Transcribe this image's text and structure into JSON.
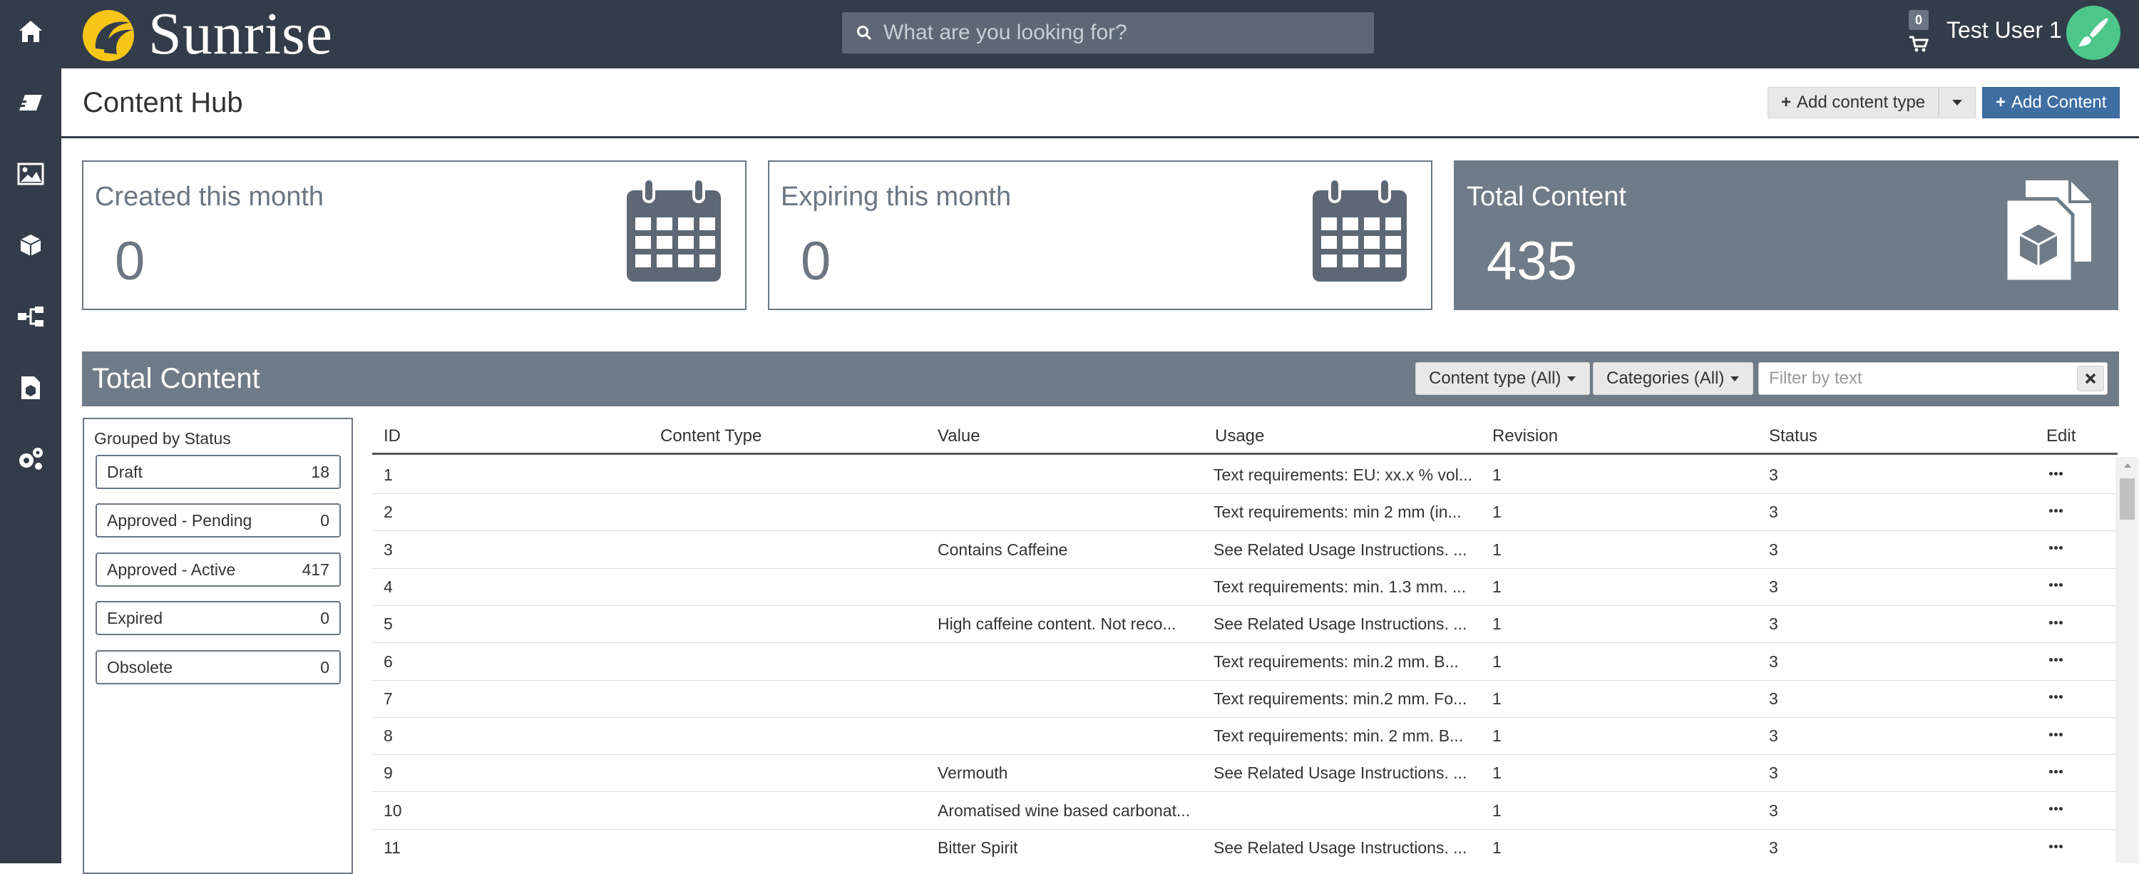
{
  "app": {
    "brand": "Sunrise"
  },
  "search": {
    "placeholder": "What are you looking for?"
  },
  "cart": {
    "count": "0"
  },
  "user": {
    "name": "Test User 1"
  },
  "sidebar": {
    "items": [
      {
        "icon": "home-icon"
      },
      {
        "icon": "eraser-icon"
      },
      {
        "icon": "image-icon"
      },
      {
        "icon": "cubes-icon"
      },
      {
        "icon": "sitemap-icon"
      },
      {
        "icon": "file-icon"
      },
      {
        "icon": "gears-icon"
      }
    ]
  },
  "page": {
    "title": "Content Hub",
    "add_content_type_label": "Add content type",
    "add_content_label": "Add Content"
  },
  "cards": [
    {
      "title": "Created this month",
      "value": "0"
    },
    {
      "title": "Expiring this month",
      "value": "0"
    },
    {
      "title": "Total Content",
      "value": "435"
    }
  ],
  "section": {
    "title": "Total Content",
    "content_type_filter": "Content type (All)",
    "categories_filter": "Categories (All)",
    "filter_placeholder": "Filter by text"
  },
  "groups": {
    "title": "Grouped by Status",
    "items": [
      {
        "label": "Draft",
        "count": "18"
      },
      {
        "label": "Approved - Pending",
        "count": "0"
      },
      {
        "label": "Approved - Active",
        "count": "417"
      },
      {
        "label": "Expired",
        "count": "0"
      },
      {
        "label": "Obsolete",
        "count": "0"
      }
    ]
  },
  "table": {
    "headers": [
      "ID",
      "Content Type",
      "Value",
      "Usage",
      "Revision",
      "Status",
      "Edit"
    ],
    "rows": [
      {
        "id": "1",
        "type": "",
        "value": "",
        "usage": "Text requirements: EU: xx.x % vol...",
        "revision": "1",
        "status": "3"
      },
      {
        "id": "2",
        "type": "",
        "value": "",
        "usage": "Text requirements: min 2 mm  (in...",
        "revision": "1",
        "status": "3"
      },
      {
        "id": "3",
        "type": "",
        "value": "Contains Caffeine",
        "usage": "See Related Usage Instructions. ...",
        "revision": "1",
        "status": "3"
      },
      {
        "id": "4",
        "type": "",
        "value": "",
        "usage": "Text requirements: min. 1.3 mm. ...",
        "revision": "1",
        "status": "3"
      },
      {
        "id": "5",
        "type": "",
        "value": "High caffeine content. Not reco...",
        "usage": "See Related Usage Instructions. ...",
        "revision": "1",
        "status": "3"
      },
      {
        "id": "6",
        "type": "",
        "value": "",
        "usage": "Text requirements: min.2 mm. B...",
        "revision": "1",
        "status": "3"
      },
      {
        "id": "7",
        "type": "",
        "value": "",
        "usage": "Text requirements: min.2 mm. Fo...",
        "revision": "1",
        "status": "3"
      },
      {
        "id": "8",
        "type": "",
        "value": "",
        "usage": "Text requirements: min. 2 mm. B...",
        "revision": "1",
        "status": "3"
      },
      {
        "id": "9",
        "type": "",
        "value": "Vermouth",
        "usage": "See Related Usage Instructions. ...",
        "revision": "1",
        "status": "3"
      },
      {
        "id": "10",
        "type": "",
        "value": "Aromatised wine based carbonat...",
        "usage": "",
        "revision": "1",
        "status": "3"
      },
      {
        "id": "11",
        "type": "",
        "value": "Bitter Spirit",
        "usage": "See Related Usage Instructions. ...",
        "revision": "1",
        "status": "3"
      }
    ]
  },
  "colors": {
    "nav_bg": "#333d49",
    "accent": "#3f6ea3",
    "card_dark": "#6f7c88",
    "logo_sun": "#f5c518",
    "avatar": "#4cc68a"
  }
}
